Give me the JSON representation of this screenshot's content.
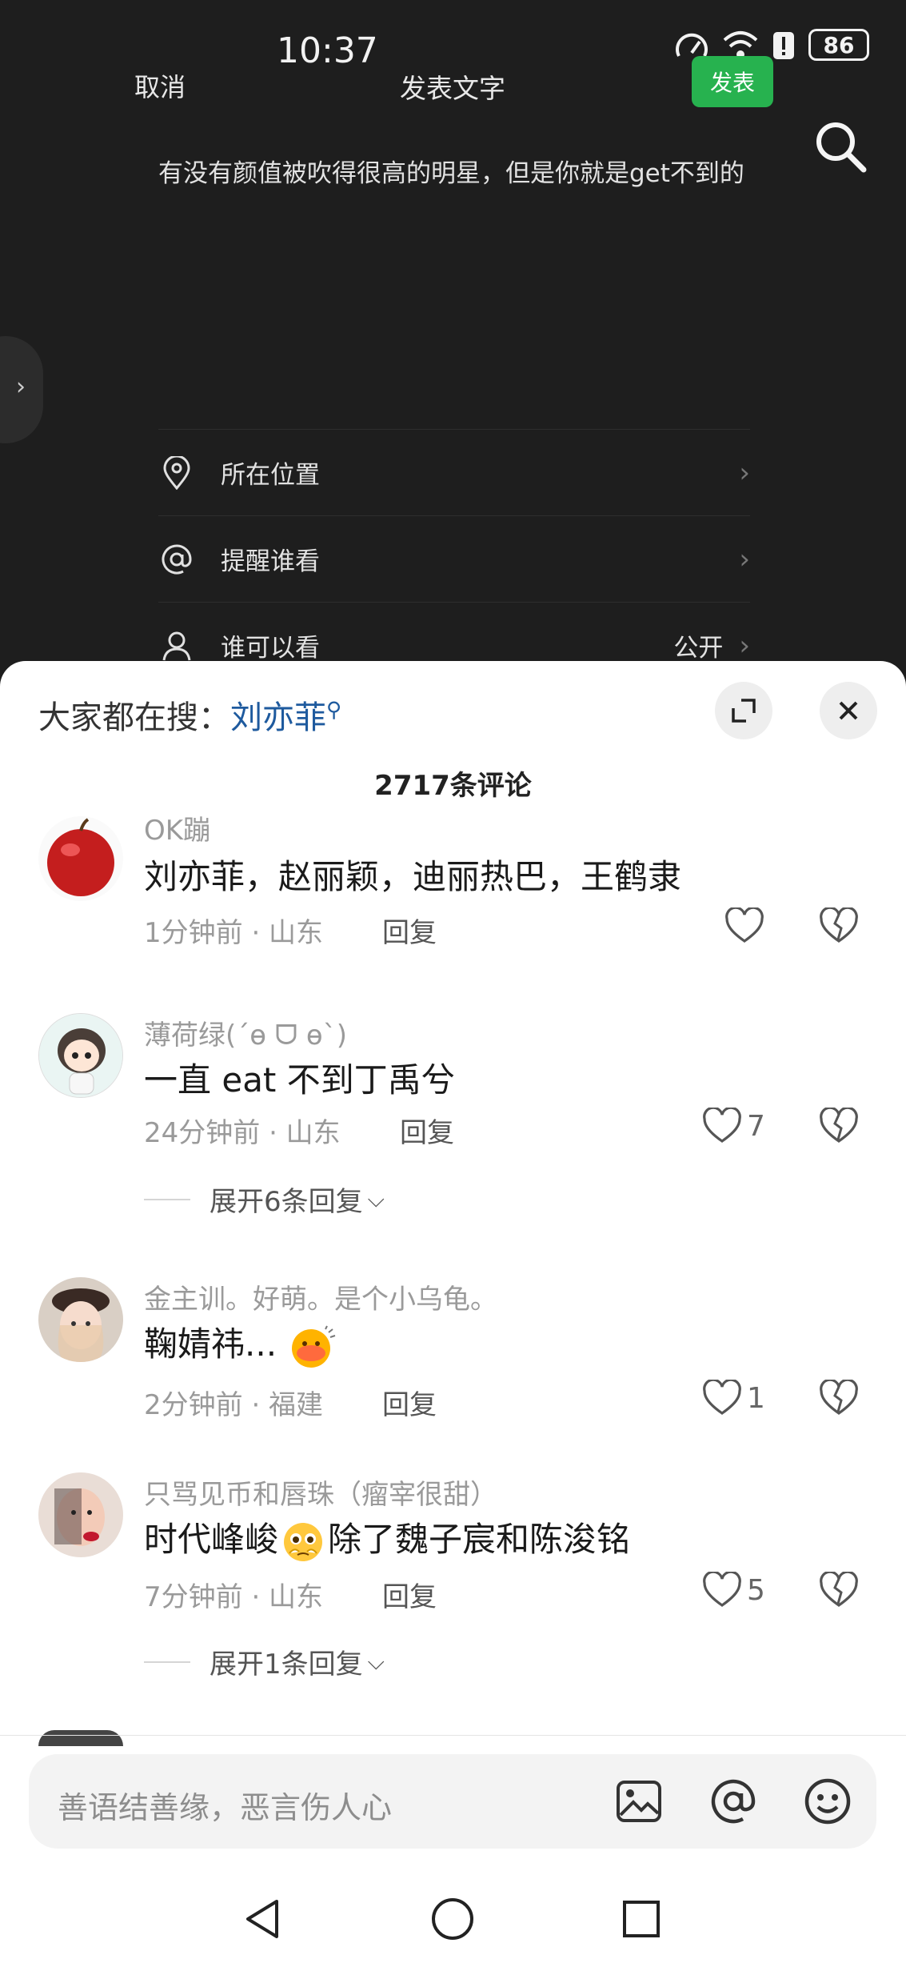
{
  "status_bar": {
    "time": "10:37",
    "battery": "86"
  },
  "header": {
    "cancel_label": "取消",
    "title": "发表文字",
    "publish_label": "发表"
  },
  "post": {
    "text": "有没有颜值被吹得很高的明星，但是你就是get不到的"
  },
  "options": [
    {
      "icon": "location-pin-icon",
      "label": "所在位置",
      "value": ""
    },
    {
      "icon": "at-icon",
      "label": "提醒谁看",
      "value": ""
    },
    {
      "icon": "person-icon",
      "label": "谁可以看",
      "value": "公开"
    }
  ],
  "sheet": {
    "hot_search_prefix": "大家都在搜：",
    "hot_search_keyword": "刘亦菲",
    "comment_count_title": "2717条评论"
  },
  "comments": [
    {
      "user": "OK蹦",
      "text": "刘亦菲，赵丽颖，迪丽热巴，王鹤隶",
      "time_location": "1分钟前 · 山东",
      "reply_label": "回复",
      "likes": "",
      "expand_label": ""
    },
    {
      "user": "薄荷绿(´ө ᗜ ө`)",
      "text": "一直 eat 不到丁禹兮",
      "time_location": "24分钟前 · 山东",
      "reply_label": "回复",
      "likes": "7",
      "expand_label": "展开6条回复"
    },
    {
      "user": "金主训。好萌。是个小乌龟。",
      "text": "鞠婧祎...",
      "time_location": "2分钟前 · 福建",
      "reply_label": "回复",
      "likes": "1",
      "expand_label": ""
    },
    {
      "user": "只骂见币和唇珠（瘤宰很甜）",
      "text_before": "时代峰峻",
      "text_after": "除了魏子宸和陈浚铭",
      "time_location": "7分钟前 · 山东",
      "reply_label": "回复",
      "likes": "5",
      "expand_label": "展开1条回复"
    }
  ],
  "input": {
    "placeholder": "善语结善缘，恶言伤人心"
  },
  "colors": {
    "publish_green": "#27b24f",
    "keyword_blue": "#1e5a9e"
  }
}
